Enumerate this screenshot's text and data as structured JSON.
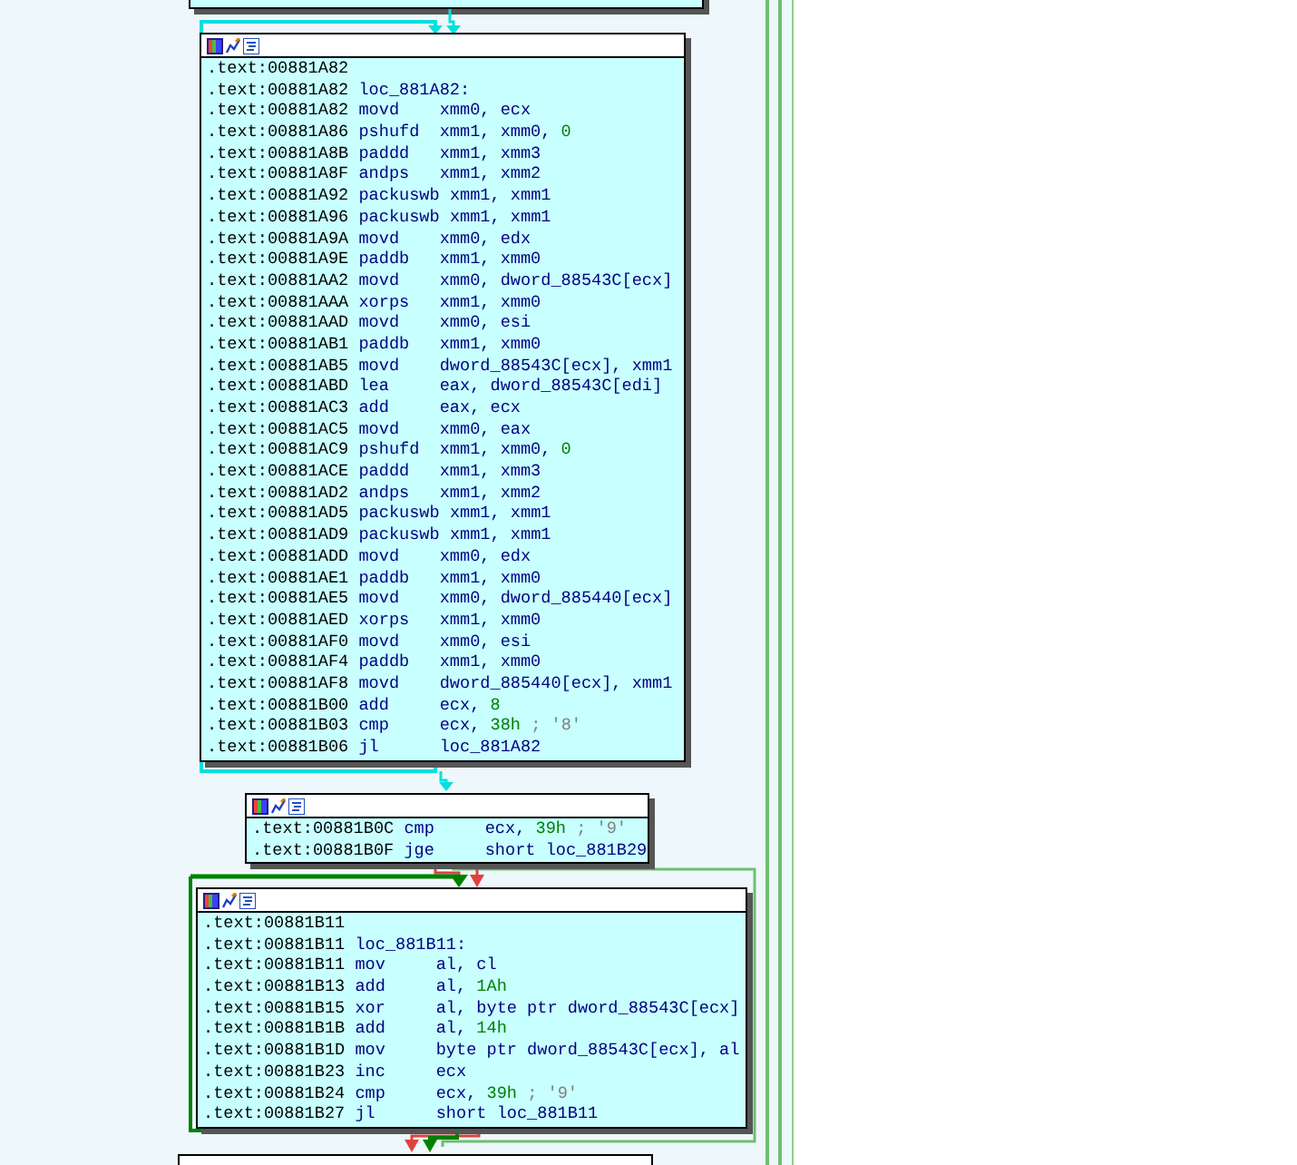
{
  "blocks": [
    {
      "kind": "code",
      "lines": [
        {
          "address": ".text:00881A82"
        },
        {
          "address": ".text:00881A82",
          "label": "loc_881A82:"
        },
        {
          "address": ".text:00881A82",
          "mnemonic": "movd",
          "operands": [
            {
              "kind": "text",
              "text": "xmm0, ecx"
            }
          ]
        },
        {
          "address": ".text:00881A86",
          "mnemonic": "pshufd",
          "operands": [
            {
              "kind": "text",
              "text": "xmm1, xmm0, "
            },
            {
              "kind": "number",
              "text": "0"
            }
          ]
        },
        {
          "address": ".text:00881A8B",
          "mnemonic": "paddd",
          "operands": [
            {
              "kind": "text",
              "text": "xmm1, xmm3"
            }
          ]
        },
        {
          "address": ".text:00881A8F",
          "mnemonic": "andps",
          "operands": [
            {
              "kind": "text",
              "text": "xmm1, xmm2"
            }
          ]
        },
        {
          "address": ".text:00881A92",
          "mnemonic": "packuswb",
          "operands": [
            {
              "kind": "text",
              "text": "xmm1, xmm1"
            }
          ]
        },
        {
          "address": ".text:00881A96",
          "mnemonic": "packuswb",
          "operands": [
            {
              "kind": "text",
              "text": "xmm1, xmm1"
            }
          ]
        },
        {
          "address": ".text:00881A9A",
          "mnemonic": "movd",
          "operands": [
            {
              "kind": "text",
              "text": "xmm0, edx"
            }
          ]
        },
        {
          "address": ".text:00881A9E",
          "mnemonic": "paddb",
          "operands": [
            {
              "kind": "text",
              "text": "xmm1, xmm0"
            }
          ]
        },
        {
          "address": ".text:00881AA2",
          "mnemonic": "movd",
          "operands": [
            {
              "kind": "text",
              "text": "xmm0, dword_88543C[ecx]"
            }
          ]
        },
        {
          "address": ".text:00881AAA",
          "mnemonic": "xorps",
          "operands": [
            {
              "kind": "text",
              "text": "xmm1, xmm0"
            }
          ]
        },
        {
          "address": ".text:00881AAD",
          "mnemonic": "movd",
          "operands": [
            {
              "kind": "text",
              "text": "xmm0, esi"
            }
          ]
        },
        {
          "address": ".text:00881AB1",
          "mnemonic": "paddb",
          "operands": [
            {
              "kind": "text",
              "text": "xmm1, xmm0"
            }
          ]
        },
        {
          "address": ".text:00881AB5",
          "mnemonic": "movd",
          "operands": [
            {
              "kind": "text",
              "text": "dword_88543C[ecx], xmm1"
            }
          ]
        },
        {
          "address": ".text:00881ABD",
          "mnemonic": "lea",
          "operands": [
            {
              "kind": "text",
              "text": "eax, dword_88543C[edi]"
            }
          ]
        },
        {
          "address": ".text:00881AC3",
          "mnemonic": "add",
          "operands": [
            {
              "kind": "text",
              "text": "eax, ecx"
            }
          ]
        },
        {
          "address": ".text:00881AC5",
          "mnemonic": "movd",
          "operands": [
            {
              "kind": "text",
              "text": "xmm0, eax"
            }
          ]
        },
        {
          "address": ".text:00881AC9",
          "mnemonic": "pshufd",
          "operands": [
            {
              "kind": "text",
              "text": "xmm1, xmm0, "
            },
            {
              "kind": "number",
              "text": "0"
            }
          ]
        },
        {
          "address": ".text:00881ACE",
          "mnemonic": "paddd",
          "operands": [
            {
              "kind": "text",
              "text": "xmm1, xmm3"
            }
          ]
        },
        {
          "address": ".text:00881AD2",
          "mnemonic": "andps",
          "operands": [
            {
              "kind": "text",
              "text": "xmm1, xmm2"
            }
          ]
        },
        {
          "address": ".text:00881AD5",
          "mnemonic": "packuswb",
          "operands": [
            {
              "kind": "text",
              "text": "xmm1, xmm1"
            }
          ]
        },
        {
          "address": ".text:00881AD9",
          "mnemonic": "packuswb",
          "operands": [
            {
              "kind": "text",
              "text": "xmm1, xmm1"
            }
          ]
        },
        {
          "address": ".text:00881ADD",
          "mnemonic": "movd",
          "operands": [
            {
              "kind": "text",
              "text": "xmm0, edx"
            }
          ]
        },
        {
          "address": ".text:00881AE1",
          "mnemonic": "paddb",
          "operands": [
            {
              "kind": "text",
              "text": "xmm1, xmm0"
            }
          ]
        },
        {
          "address": ".text:00881AE5",
          "mnemonic": "movd",
          "operands": [
            {
              "kind": "text",
              "text": "xmm0, dword_885440[ecx]"
            }
          ]
        },
        {
          "address": ".text:00881AED",
          "mnemonic": "xorps",
          "operands": [
            {
              "kind": "text",
              "text": "xmm1, xmm0"
            }
          ]
        },
        {
          "address": ".text:00881AF0",
          "mnemonic": "movd",
          "operands": [
            {
              "kind": "text",
              "text": "xmm0, esi"
            }
          ]
        },
        {
          "address": ".text:00881AF4",
          "mnemonic": "paddb",
          "operands": [
            {
              "kind": "text",
              "text": "xmm1, xmm0"
            }
          ]
        },
        {
          "address": ".text:00881AF8",
          "mnemonic": "movd",
          "operands": [
            {
              "kind": "text",
              "text": "dword_885440[ecx], xmm1"
            }
          ]
        },
        {
          "address": ".text:00881B00",
          "mnemonic": "add",
          "operands": [
            {
              "kind": "text",
              "text": "ecx, "
            },
            {
              "kind": "number",
              "text": "8"
            }
          ]
        },
        {
          "address": ".text:00881B03",
          "mnemonic": "cmp",
          "operands": [
            {
              "kind": "text",
              "text": "ecx, "
            },
            {
              "kind": "number",
              "text": "38h"
            },
            {
              "kind": "comment",
              "text": " ; '8'"
            }
          ]
        },
        {
          "address": ".text:00881B06",
          "mnemonic": "jl",
          "operands": [
            {
              "kind": "text",
              "text": "loc_881A82"
            }
          ]
        }
      ]
    },
    {
      "kind": "code",
      "lines": [
        {
          "address": ".text:00881B0C",
          "mnemonic": "cmp",
          "operands": [
            {
              "kind": "text",
              "text": "ecx, "
            },
            {
              "kind": "number",
              "text": "39h"
            },
            {
              "kind": "comment",
              "text": " ; '9'"
            }
          ]
        },
        {
          "address": ".text:00881B0F",
          "mnemonic": "jge",
          "operands": [
            {
              "kind": "text",
              "text": "short loc_881B29"
            }
          ]
        }
      ]
    },
    {
      "kind": "code",
      "lines": [
        {
          "address": ".text:00881B11"
        },
        {
          "address": ".text:00881B11",
          "label": "loc_881B11:"
        },
        {
          "address": ".text:00881B11",
          "mnemonic": "mov",
          "operands": [
            {
              "kind": "text",
              "text": "al, cl"
            }
          ]
        },
        {
          "address": ".text:00881B13",
          "mnemonic": "add",
          "operands": [
            {
              "kind": "text",
              "text": "al, "
            },
            {
              "kind": "number",
              "text": "1Ah"
            }
          ]
        },
        {
          "address": ".text:00881B15",
          "mnemonic": "xor",
          "operands": [
            {
              "kind": "text",
              "text": "al, byte ptr dword_88543C[ecx]"
            }
          ]
        },
        {
          "address": ".text:00881B1B",
          "mnemonic": "add",
          "operands": [
            {
              "kind": "text",
              "text": "al, "
            },
            {
              "kind": "number",
              "text": "14h"
            }
          ]
        },
        {
          "address": ".text:00881B1D",
          "mnemonic": "mov",
          "operands": [
            {
              "kind": "text",
              "text": "byte ptr dword_88543C[ecx], al"
            }
          ]
        },
        {
          "address": ".text:00881B23",
          "mnemonic": "inc",
          "operands": [
            {
              "kind": "text",
              "text": "ecx"
            }
          ]
        },
        {
          "address": ".text:00881B24",
          "mnemonic": "cmp",
          "operands": [
            {
              "kind": "text",
              "text": "ecx, "
            },
            {
              "kind": "number",
              "text": "39h"
            },
            {
              "kind": "comment",
              "text": " ; '9'"
            }
          ]
        },
        {
          "address": ".text:00881B27",
          "mnemonic": "jl",
          "operands": [
            {
              "kind": "text",
              "text": "short loc_881B11"
            }
          ]
        }
      ]
    }
  ]
}
